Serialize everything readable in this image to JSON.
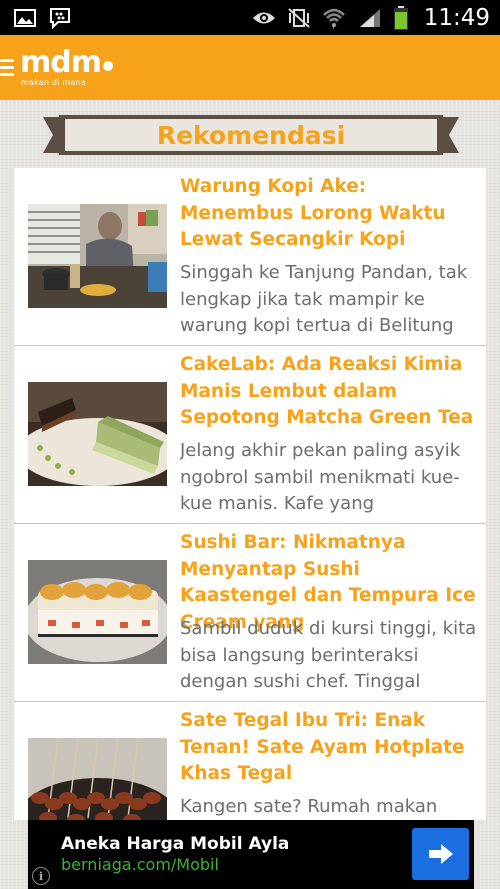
{
  "status_bar": {
    "time": "11:49",
    "icons": [
      "image-icon",
      "bbm-icon",
      "eye-icon",
      "vibrate-mute-icon",
      "wifi-icon",
      "signal-icon",
      "battery-icon"
    ]
  },
  "app": {
    "logo_text": "mdm",
    "logo_subtitle": "makan di mana",
    "accent_color": "#f7a21b"
  },
  "section": {
    "title": "Rekomendasi"
  },
  "articles": [
    {
      "title": "Warung Kopi Ake: Menembus Lorong Waktu Lewat Secangkir Kopi",
      "description": "Singgah ke Tanjung Pandan, tak lengkap jika tak mampir ke warung kopi tertua di Belitung",
      "image": "coffee-shop-photo"
    },
    {
      "title": "CakeLab: Ada Reaksi Kimia Manis Lembut dalam Sepotong Matcha Green Tea",
      "description": "Jelang akhir pekan paling asyik ngobrol sambil menikmati kue-kue manis. Kafe yang",
      "image": "matcha-cake-photo"
    },
    {
      "title": "Sushi Bar: Nikmatnya Menyantap Sushi Kaastengel dan Tempura Ice Cream yang",
      "description": "Sambil duduk di kursi tinggi, kita bisa langsung berinteraksi dengan sushi chef. Tinggal",
      "image": "sushi-roll-photo"
    },
    {
      "title": "Sate Tegal Ibu Tri: Enak Tenan! Sate Ayam Hotplate Khas Tegal",
      "description": "Kangen sate? Rumah makan",
      "image": "satay-photo"
    }
  ],
  "ad": {
    "title": "Aneka Harga Mobil Ayla",
    "url": "berniaga.com/Mobil",
    "info_label": "i"
  }
}
